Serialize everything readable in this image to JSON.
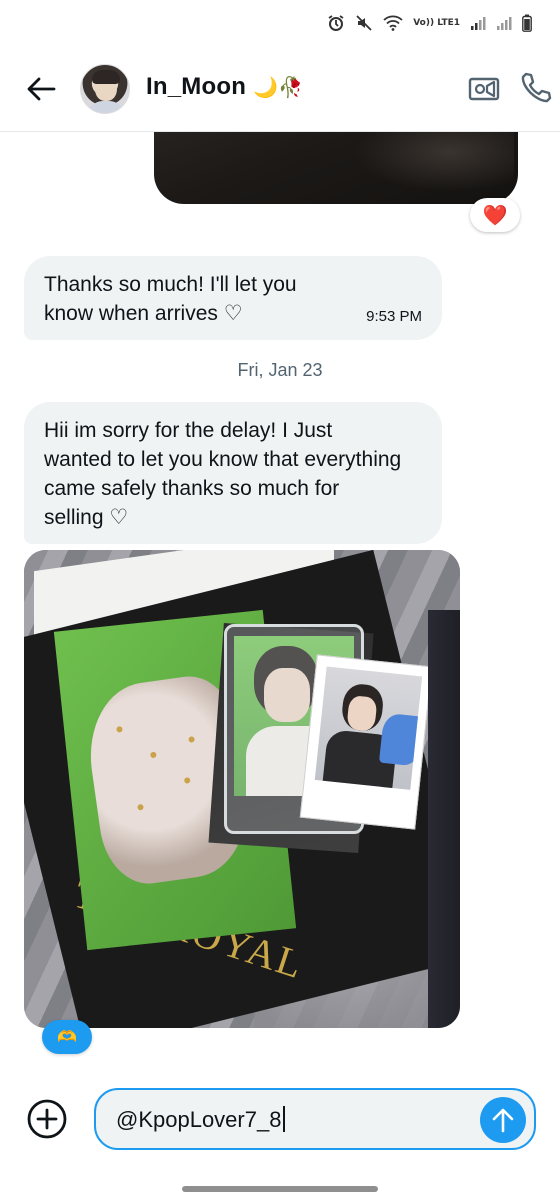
{
  "status_bar": {
    "network_label": "Vo)) LTE1",
    "icons": [
      "alarm-icon",
      "mute-icon",
      "wifi-icon",
      "signal-icon",
      "signal-icon",
      "battery-icon"
    ]
  },
  "header": {
    "contact_name": "In_Moon",
    "name_emoji": "🌙🥀",
    "back_icon": "arrow-left-icon",
    "video_icon": "video-call-icon",
    "call_icon": "phone-icon"
  },
  "conversation": {
    "sent_media_reaction": "❤️",
    "messages": [
      {
        "text": "Thanks so much! I'll let you know when arrives ♡",
        "time": "9:53 PM"
      },
      {
        "text": "Hii im sorry for the delay! I Just wanted to let you know that everything came safely thanks so much for selling ♡"
      }
    ],
    "date_separator": "Fri, Jan 23",
    "photo_album_text": "THE ROYAL",
    "photo_reaction": "🫶"
  },
  "composer": {
    "add_icon": "plus-circle-icon",
    "input_value": "@KpopLover7_8",
    "send_icon": "arrow-up-icon"
  },
  "colors": {
    "accent": "#1d9bf0",
    "bubble": "#eff3f4",
    "heart": "#f91880",
    "text": "#0f1419",
    "muted": "#536471"
  }
}
